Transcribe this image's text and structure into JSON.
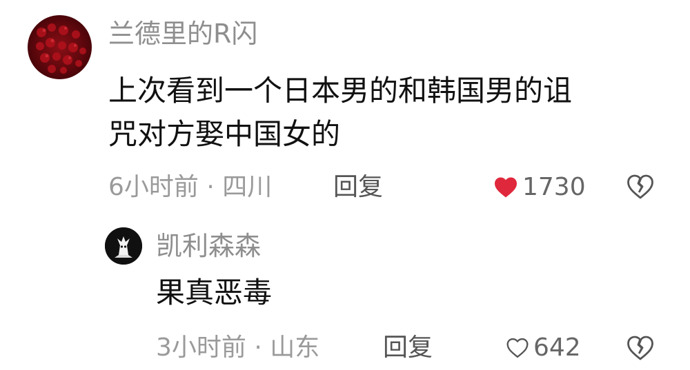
{
  "comment": {
    "username": "兰德里的R闪",
    "text_line1": "上次看到一个日本男的和韩国男的诅",
    "text_line2": "咒对方娶中国女的",
    "meta": "6小时前 · 四川",
    "reply_label": "回复",
    "likes": "1730",
    "liked": true,
    "like_icon": "heart-filled-icon",
    "dislike_icon": "broken-heart-icon",
    "accent_color": "#e0283c"
  },
  "reply": {
    "username": "凯利森森",
    "text": "果真恶毒",
    "meta": "3小时前 · 山东",
    "reply_label": "回复",
    "likes": "642",
    "liked": false,
    "like_icon": "heart-outline-icon",
    "dislike_icon": "broken-heart-icon"
  }
}
